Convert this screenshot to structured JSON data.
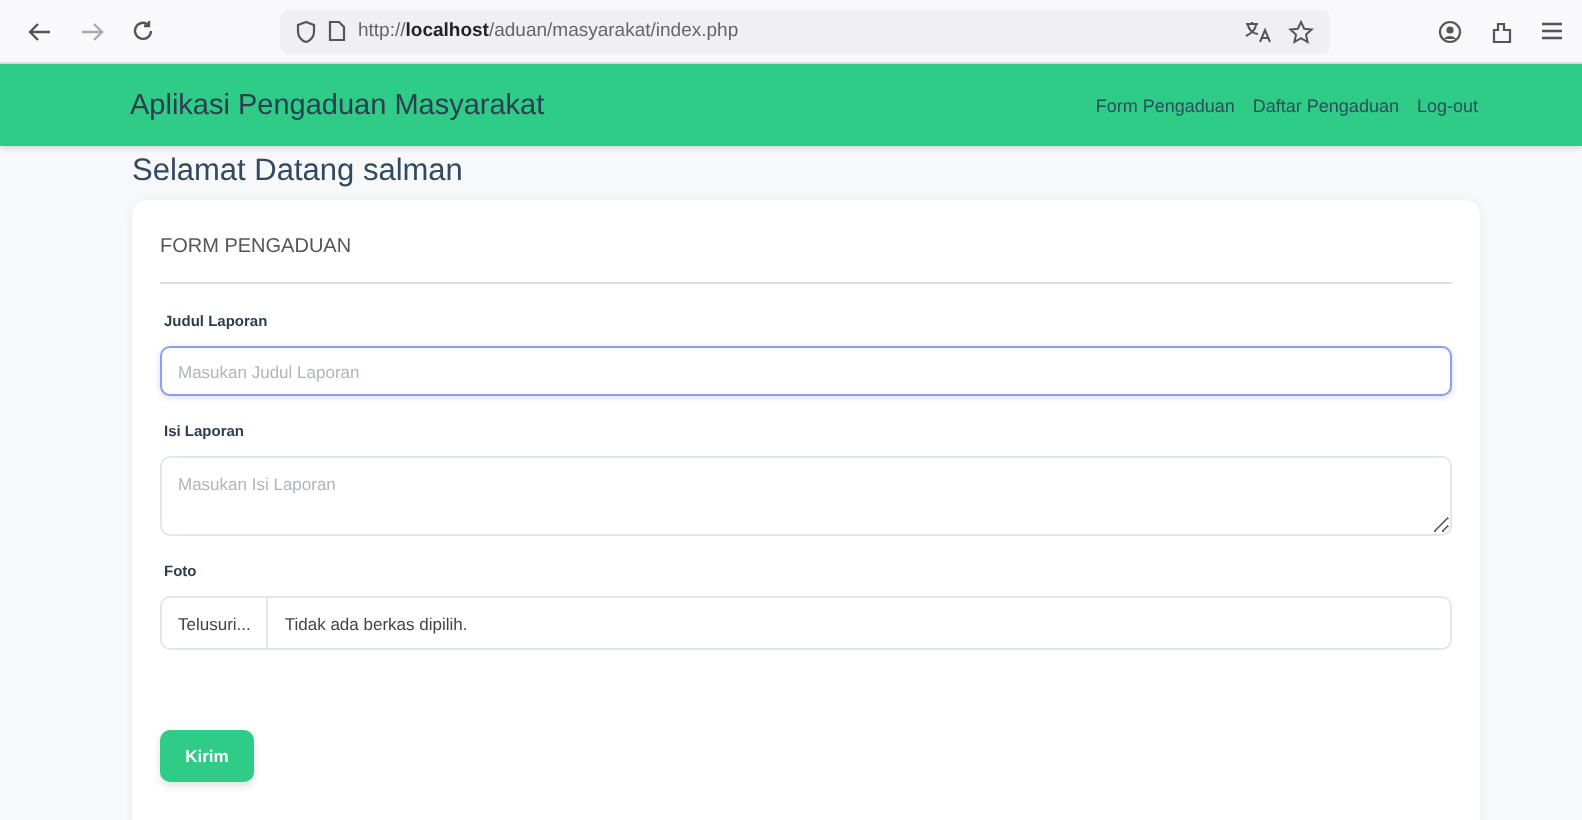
{
  "browser": {
    "url": "http://**localhost**/aduan/masyarakat/index.php"
  },
  "navbar": {
    "brand": "Aplikasi Pengaduan Masyarakat",
    "links": [
      {
        "label": "Form Pengaduan"
      },
      {
        "label": "Daftar Pengaduan"
      },
      {
        "label": "Log-out"
      }
    ]
  },
  "greeting": "Selamat Datang salman",
  "form": {
    "title": "FORM PENGADUAN",
    "fields": [
      {
        "kind": "text",
        "label": "Judul Laporan",
        "placeholder": "Masukan Judul Laporan",
        "focused": true
      },
      {
        "kind": "textarea",
        "label": "Isi Laporan",
        "placeholder": "Masukan Isi Laporan",
        "focused": false
      },
      {
        "kind": "file",
        "label": "Foto",
        "button": "Telusuri...",
        "status": "Tidak ada berkas dipilih.",
        "focused": false
      }
    ],
    "submit": "Kirim"
  }
}
